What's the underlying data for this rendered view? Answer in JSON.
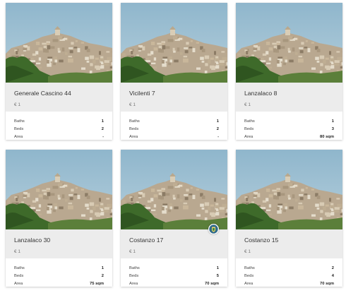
{
  "listings": [
    {
      "title": "Generale Cascino 44",
      "price": "€ 1",
      "baths_label": "Baths",
      "baths": "1",
      "beds_label": "Beds",
      "beds": "2",
      "area_label": "Area",
      "area": "-"
    },
    {
      "title": "Vicilenti 7",
      "price": "€ 1",
      "baths_label": "Baths",
      "baths": "1",
      "beds_label": "Beds",
      "beds": "2",
      "area_label": "Area",
      "area": "-"
    },
    {
      "title": "Lanzalaco 8",
      "price": "€ 1",
      "baths_label": "Baths",
      "baths": "1",
      "beds_label": "Beds",
      "beds": "3",
      "area_label": "Area",
      "area": "80 sqm"
    },
    {
      "title": "Lanzalaco 30",
      "price": "€ 1",
      "baths_label": "Baths",
      "baths": "1",
      "beds_label": "Beds",
      "beds": "2",
      "area_label": "Area",
      "area": "75 sqm"
    },
    {
      "title": "Costanzo 17",
      "price": "€ 1",
      "baths_label": "Baths",
      "baths": "1",
      "beds_label": "Beds",
      "beds": "5",
      "area_label": "Area",
      "area": "70 sqm",
      "badge_icon": "town-crest-icon"
    },
    {
      "title": "Costanzo 15",
      "price": "€ 1",
      "baths_label": "Baths",
      "baths": "2",
      "beds_label": "Beds",
      "beds": "4",
      "area_label": "Area",
      "area": "70 sqm"
    }
  ],
  "colors": {
    "card_header_bg": "#ececec",
    "sky": "#9bbdd0",
    "hill_green": "#3e6a2a"
  }
}
